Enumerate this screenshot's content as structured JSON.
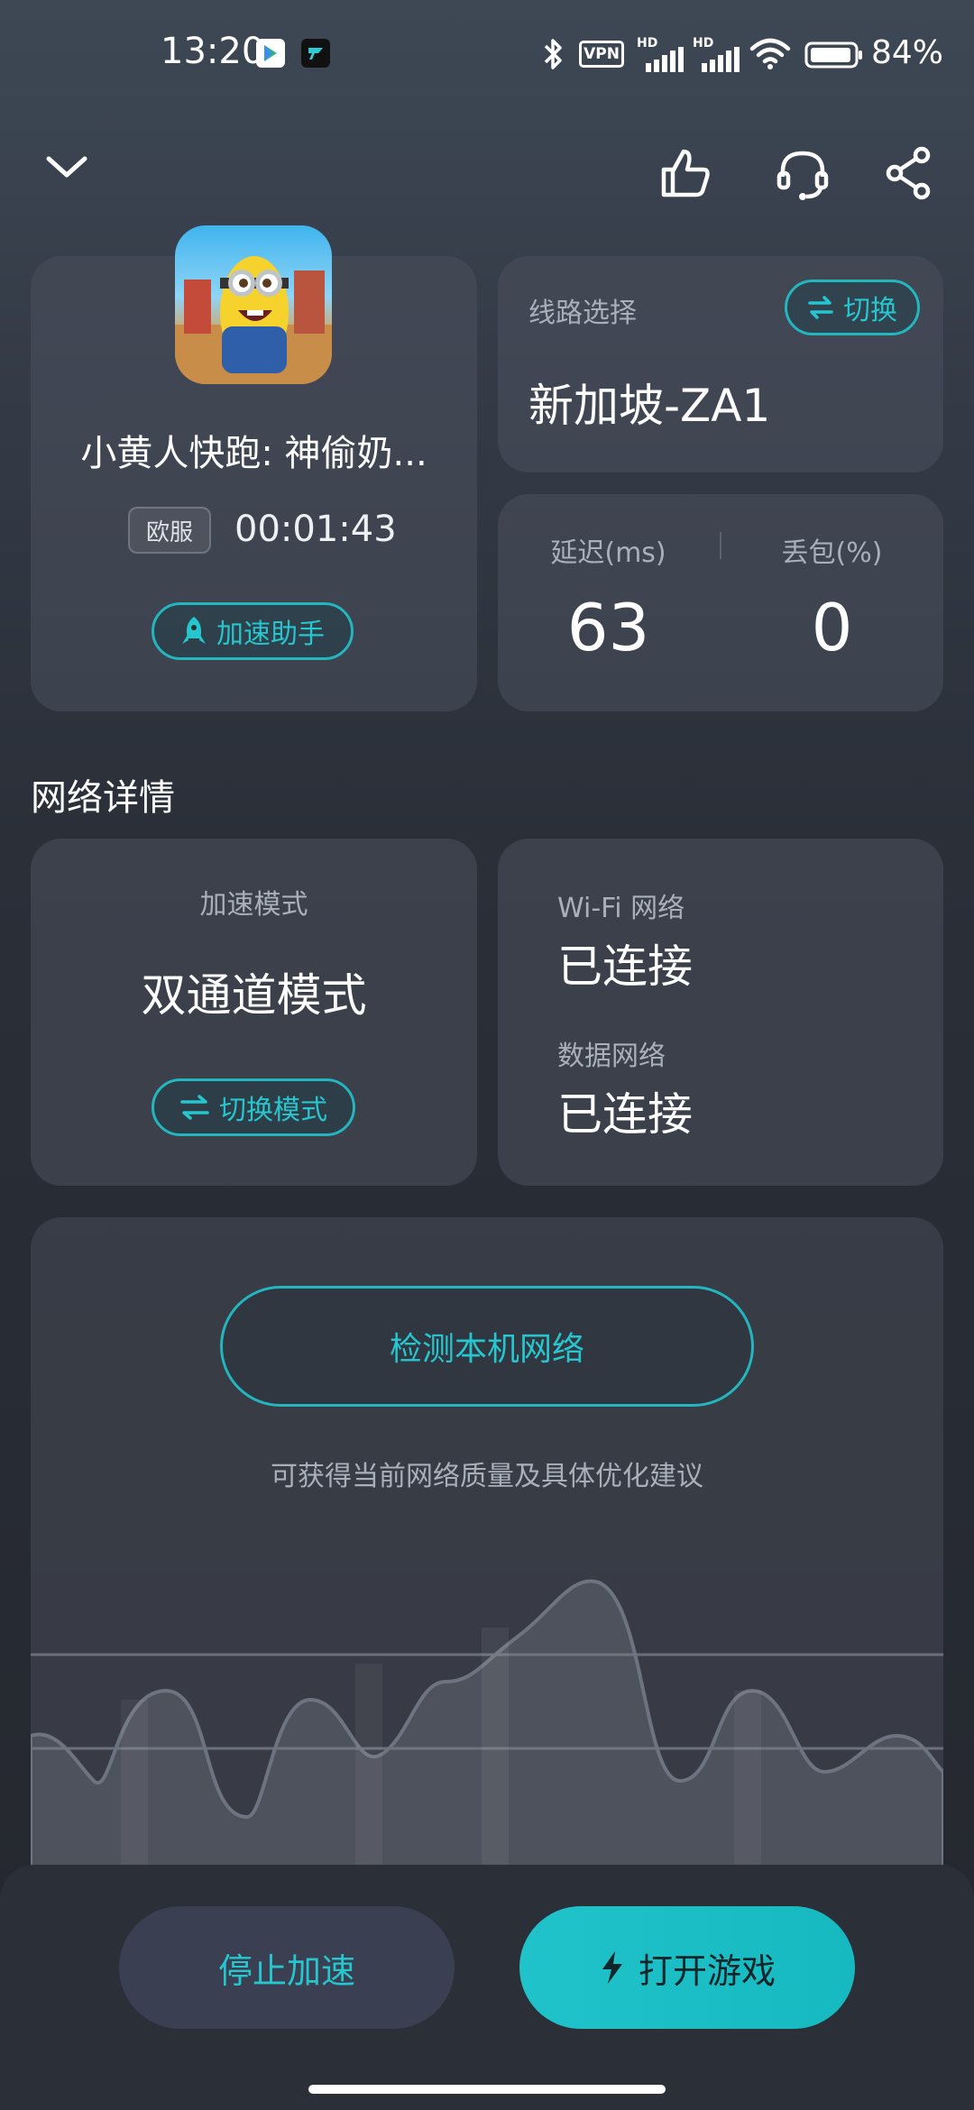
{
  "status_bar": {
    "time": "13:20",
    "battery": "84%",
    "vpn": "VPN",
    "hd": "HD"
  },
  "game": {
    "title": "小黄人快跑: 神偷奶...",
    "region": "欧服",
    "timer": "00:01:43",
    "assist_label": "加速助手"
  },
  "route": {
    "label": "线路选择",
    "switch_label": "切换",
    "server": "新加坡-ZA1"
  },
  "stats": {
    "latency_label": "延迟(ms)",
    "latency_value": "63",
    "loss_label": "丢包(%)",
    "loss_value": "0"
  },
  "section_title": "网络详情",
  "mode": {
    "label": "加速模式",
    "value": "双通道模式",
    "switch_label": "切换模式"
  },
  "network": {
    "wifi_label": "Wi-Fi 网络",
    "wifi_status": "已连接",
    "data_label": "数据网络",
    "data_status": "已连接"
  },
  "detect": {
    "button_label": "检测本机网络",
    "hint": "可获得当前网络质量及具体优化建议"
  },
  "footer": {
    "stop_label": "停止加速",
    "open_label": "打开游戏"
  },
  "colors": {
    "accent": "#23b6bf",
    "card_bg": "#3c424d",
    "background": "#2a2f38"
  }
}
